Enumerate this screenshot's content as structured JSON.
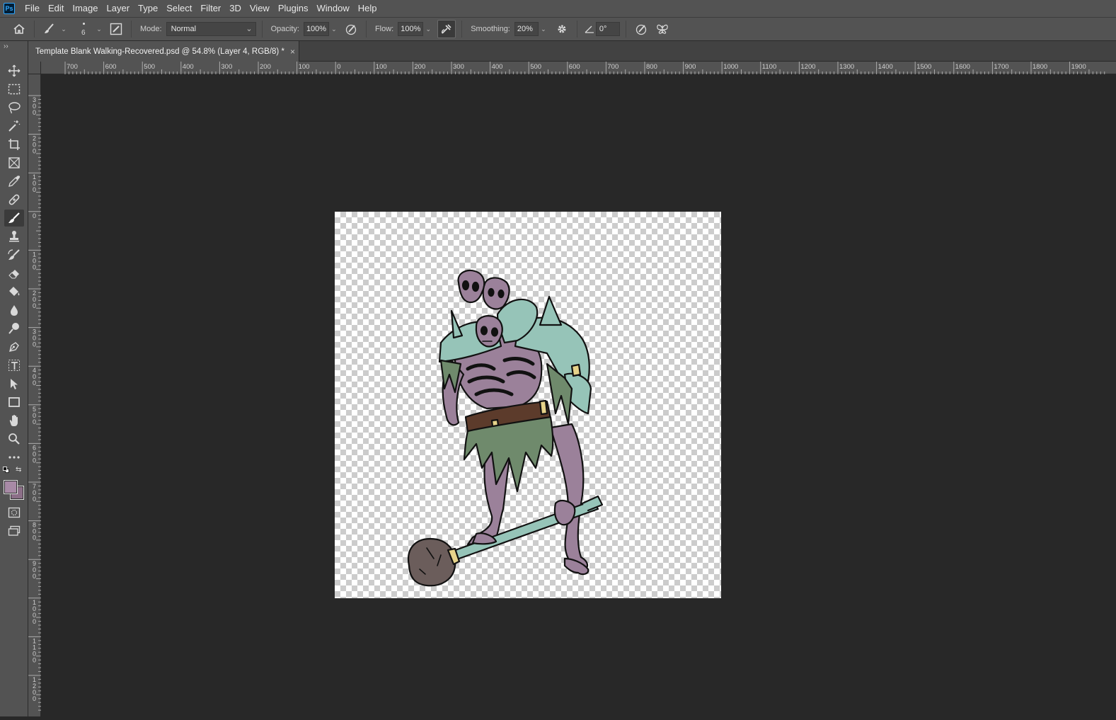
{
  "app": {
    "logo": "Ps"
  },
  "menu": [
    "File",
    "Edit",
    "Image",
    "Layer",
    "Type",
    "Select",
    "Filter",
    "3D",
    "View",
    "Plugins",
    "Window",
    "Help"
  ],
  "options": {
    "brush_size": "6",
    "mode_label": "Mode:",
    "mode_value": "Normal",
    "opacity_label": "Opacity:",
    "opacity_value": "100%",
    "flow_label": "Flow:",
    "flow_value": "100%",
    "smoothing_label": "Smoothing:",
    "smoothing_value": "20%",
    "angle_value": "0°"
  },
  "document": {
    "tab_title": "Template Blank Walking-Recovered.psd @ 54.8% (Layer 4, RGB/8) *",
    "close_glyph": "×"
  },
  "ruler": {
    "top_labels": [
      "700",
      "600",
      "500",
      "400",
      "300",
      "200",
      "100",
      "0",
      "100",
      "200",
      "300",
      "400",
      "500",
      "600",
      "700",
      "800",
      "900",
      "1000",
      "1100",
      "1200",
      "1300",
      "1400",
      "1500",
      "1600",
      "1700",
      "1800",
      "1900"
    ],
    "left_labels": [
      "300",
      "200",
      "100",
      "0",
      "100",
      "200",
      "300",
      "400",
      "500",
      "600",
      "700",
      "800",
      "900",
      "1000",
      "1100",
      "1200"
    ]
  },
  "colors": {
    "foreground": "#a88aa6",
    "background": "#8c6f88",
    "skeleton_body": "#9b819a",
    "armor": "#96c4b8",
    "cloth": "#6f8a6c",
    "club": "#6b5d5b",
    "belt": "#5c3b2b",
    "gold": "#e6d38a"
  }
}
